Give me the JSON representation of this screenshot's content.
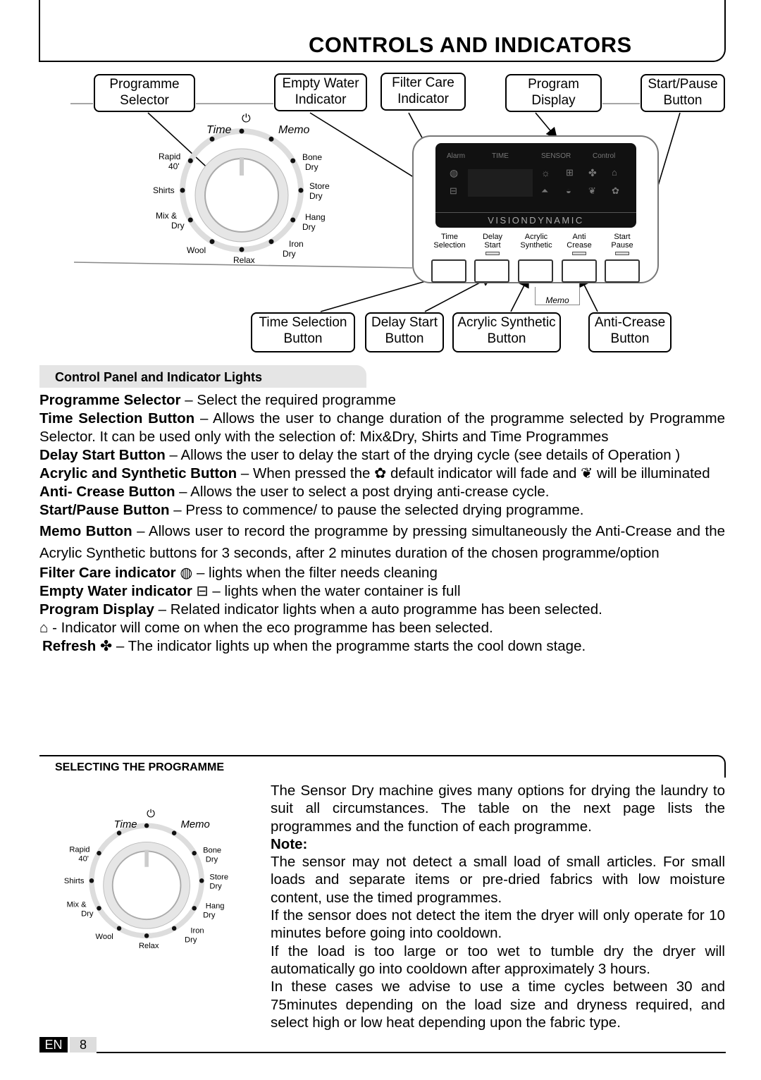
{
  "header": {
    "title": "CONTROLS AND INDICATORS"
  },
  "callouts": {
    "programme_selector": [
      "Programme",
      "Selector"
    ],
    "empty_water": [
      "Empty Water",
      "Indicator"
    ],
    "filter_care": [
      "Filter Care",
      "Indicator"
    ],
    "program_display": [
      "Program",
      "Display"
    ],
    "start_pause": [
      "Start/Pause",
      "Button"
    ],
    "time_selection": [
      "Time Selection",
      "Button"
    ],
    "delay_start": [
      "Delay Start",
      "Button"
    ],
    "acrylic_synthetic": [
      "Acrylic Synthetic",
      "Button"
    ],
    "anti_crease": [
      "Anti-Crease",
      "Button"
    ]
  },
  "dial": {
    "top": "⏻",
    "time": "Time",
    "memo": "Memo",
    "rapid": [
      "Rapid",
      "40'"
    ],
    "shirts": "Shirts",
    "mix": [
      "Mix &",
      "Dry"
    ],
    "wool": "Wool",
    "relax": "Relax",
    "iron": [
      "Iron",
      "Dry"
    ],
    "hang": [
      "Hang",
      "Dry"
    ],
    "store": [
      "Store",
      "Dry"
    ],
    "bone": [
      "Bone",
      "Dry"
    ]
  },
  "panel": {
    "screen_labels": [
      "Alarm",
      "TIME",
      "SENSOR",
      "Control"
    ],
    "brand": "VISIONDYNAMIC",
    "buttons": [
      [
        "Time",
        "Selection"
      ],
      [
        "Delay",
        "Start"
      ],
      [
        "Acrylic",
        "Synthetic"
      ],
      [
        "Anti",
        "Crease"
      ],
      [
        "Start",
        "Pause"
      ]
    ],
    "memo": "Memo"
  },
  "section1": {
    "heading": "Control Panel and Indicator Lights",
    "items": [
      {
        "term": "Programme Selector",
        "text": " – Select the required programme"
      },
      {
        "term": "Time Selection Button",
        "text": " – Allows the user to change duration of the programme selected by Programme Selector. It can be used only with the selection of: Mix&Dry, Shirts and Time Programmes"
      },
      {
        "term": "Delay Start Button",
        "text": "  – Allows the user to delay the start of the drying cycle (see details of Operation )"
      },
      {
        "term": "Acrylic and Synthetic Button",
        "text": "  – When pressed the",
        "text2": " default indicator will fade and ",
        "text3": " will be illuminated"
      },
      {
        "term": "Anti- Crease Button",
        "text": " –  Allows the user to select  a post drying anti-crease cycle."
      },
      {
        "term": "Start/Pause Button",
        "text": " – Press to commence/ to pause the selected drying programme."
      },
      {
        "term": "Memo Button",
        "text": "  –  Allows user to record the programme  by pressing simultaneously the Anti-Crease and the Acrylic Synthetic buttons for 3 seconds, after 2 minutes duration of  the chosen programme/option"
      },
      {
        "term": "Filter Care indicator",
        "text": " – lights when the filter needs cleaning"
      },
      {
        "term": "Empty Water indicator",
        "text": " – lights when the water container is full"
      },
      {
        "term": "Program Display",
        "text": "  – Related indicator lights when a auto programme has been selected."
      },
      {
        "term": "",
        "text": " - Indicator will come on  when the eco programme has been selected."
      },
      {
        "term": "Refresh",
        "text": " – The indicator lights up when the programme starts the cool down stage."
      }
    ]
  },
  "section2": {
    "heading": "SELECTING THE  PROGRAMME",
    "intro": "The Sensor Dry machine gives many options for drying the laundry to suit all circumstances. The table on the next page lists the programmes and the function of each programme.",
    "note_label": "Note:",
    "paragraphs": [
      "The sensor may not detect a small load of small articles. For small loads and separate items or pre-dried fabrics with low moisture content, use the timed programmes.",
      "If the sensor does not detect the item the dryer will only operate for 10 minutes before going into cooldown.",
      "If the load is too large or too wet to tumble dry the dryer will automatically go into cooldown after approximately 3 hours.",
      "In these cases we advise to use a time cycles between 30 and 75minutes depending on the load size and dryness required, and select high or low heat depending upon the fabric type."
    ]
  },
  "footer": {
    "lang": "EN",
    "page": "8"
  }
}
